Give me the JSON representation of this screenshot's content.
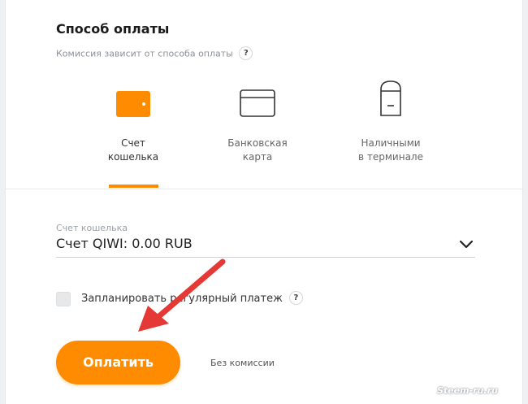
{
  "payment": {
    "title": "Способ оплаты",
    "subtitle": "Комиссия зависит от способа оплаты",
    "help_glyph": "?",
    "methods": [
      {
        "line1": "Счет",
        "line2": "кошелька",
        "icon": "wallet-icon",
        "selected": true
      },
      {
        "line1": "Банковская",
        "line2": "карта",
        "icon": "bank-card-icon",
        "selected": false
      },
      {
        "line1": "Наличными",
        "line2": "в терминале",
        "icon": "terminal-icon",
        "selected": false
      }
    ]
  },
  "account_field": {
    "label": "Счет кошелька",
    "value": "Счет QIWI: 0.00 RUB",
    "icon": "chevron-down-icon"
  },
  "schedule": {
    "label": "Запланировать регулярный платеж",
    "checked": false,
    "help_glyph": "?"
  },
  "actions": {
    "pay_label": "Оплатить",
    "fee_note": "Без комиссии"
  },
  "watermark": "Steem-ru.ru",
  "colors": {
    "accent": "#ff8c00",
    "annotation_arrow": "#e53935"
  }
}
